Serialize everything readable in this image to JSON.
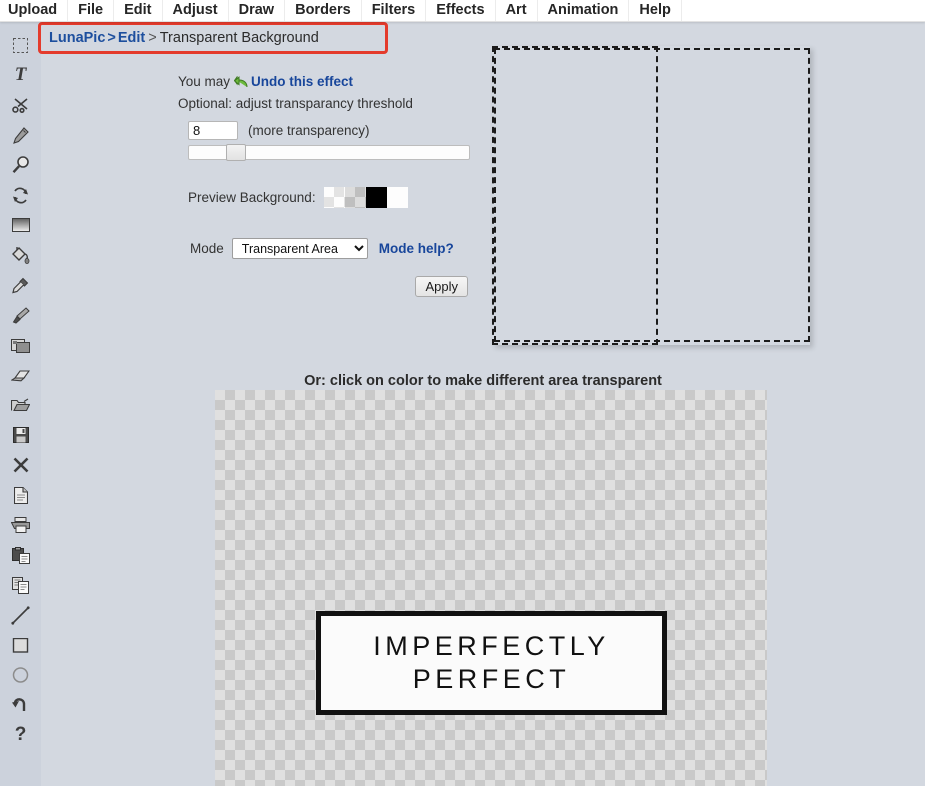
{
  "menubar": {
    "items": [
      {
        "label": "Upload"
      },
      {
        "label": "File"
      },
      {
        "label": "Edit"
      },
      {
        "label": "Adjust"
      },
      {
        "label": "Draw"
      },
      {
        "label": "Borders"
      },
      {
        "label": "Filters"
      },
      {
        "label": "Effects"
      },
      {
        "label": "Art"
      },
      {
        "label": "Animation"
      },
      {
        "label": "Help"
      }
    ]
  },
  "breadcrumb": {
    "root": "LunaPic",
    "sep1": ">",
    "section": "Edit",
    "sep2": ">",
    "current": "Transparent Background",
    "annotation_color": "#e43b2c"
  },
  "toolbar": {
    "tools": [
      {
        "name": "selection-marquee-icon"
      },
      {
        "name": "text-tool-icon"
      },
      {
        "name": "scissors-icon"
      },
      {
        "name": "pencil-icon"
      },
      {
        "name": "magnifier-icon"
      },
      {
        "name": "rotate-icon"
      },
      {
        "name": "gradient-icon"
      },
      {
        "name": "paint-bucket-icon"
      },
      {
        "name": "eyedropper-icon"
      },
      {
        "name": "paintbrush-icon"
      },
      {
        "name": "crop-image-icon"
      },
      {
        "name": "eraser-icon"
      },
      {
        "name": "open-folder-icon"
      },
      {
        "name": "save-floppy-icon"
      },
      {
        "name": "close-x-icon"
      },
      {
        "name": "document-icon"
      },
      {
        "name": "printer-icon"
      },
      {
        "name": "clipboard-paste-icon"
      },
      {
        "name": "copy-icon"
      },
      {
        "name": "line-tool-icon"
      },
      {
        "name": "rectangle-tool-icon"
      },
      {
        "name": "ellipse-tool-icon"
      },
      {
        "name": "undo-arrow-icon"
      },
      {
        "name": "help-question-icon"
      }
    ]
  },
  "controls": {
    "undo_prefix": "You may",
    "undo_link": "Undo this effect",
    "optional_text": "Optional: adjust transparancy threshold",
    "threshold_value": "8",
    "threshold_hint": "(more transparency)",
    "slider_percent": 14,
    "preview_bg_label": "Preview Background:",
    "swatches": [
      {
        "name": "checker-light",
        "color": "#fdfdfd"
      },
      {
        "name": "checker-dark",
        "color": "#dcdcdc"
      },
      {
        "name": "black",
        "color": "#000000"
      },
      {
        "name": "white",
        "color": "#fdfdfd"
      }
    ],
    "mode_label": "Mode",
    "mode_selected": "Transparent Area",
    "mode_options": [
      "Transparent Area"
    ],
    "mode_help_label": "Mode help?",
    "apply_label": "Apply",
    "link_color": "#18469b"
  },
  "caption": "Or: click on color to make different area transparent",
  "image": {
    "sign_line1": "IMPERFECTLY",
    "sign_line2": "PERFECT"
  }
}
